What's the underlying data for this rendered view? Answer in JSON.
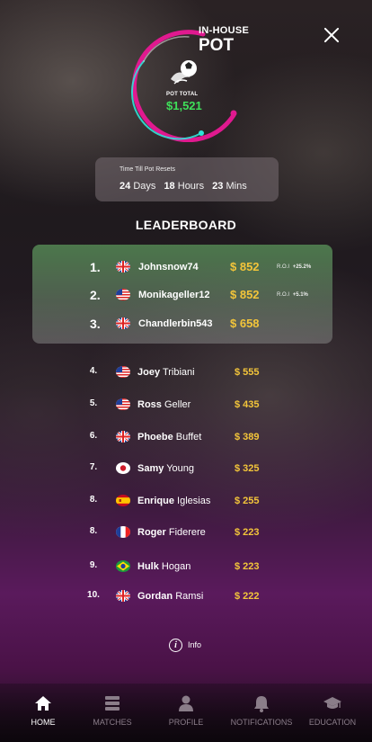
{
  "header": {
    "title_small": "IN-HOUSE",
    "title_big": "POT",
    "pot_total_label": "POT TOTAL",
    "pot_total_value": "$1,521",
    "close_icon": "close-icon"
  },
  "timer": {
    "label": "Time Till Pot Resets",
    "days": "24",
    "days_unit": "Days",
    "hours": "18",
    "hours_unit": "Hours",
    "mins": "23",
    "mins_unit": "Mins"
  },
  "leaderboard": {
    "title": "LEADERBOARD",
    "top": [
      {
        "rank": "1.",
        "flag": "uk",
        "name": "Johnsnow74",
        "amount": "$ 852",
        "roi_label": "R.O.I",
        "roi_value": "+25.2%"
      },
      {
        "rank": "2.",
        "flag": "us",
        "name": "Monikageller12",
        "amount": "$ 852",
        "roi_label": "R.O.I",
        "roi_value": "+5.1%"
      },
      {
        "rank": "3.",
        "flag": "uk",
        "name": "Chandlerbin543",
        "amount": "$ 658",
        "roi_label": "",
        "roi_value": ""
      }
    ],
    "rows": [
      {
        "rank": "4.",
        "flag": "us",
        "first": "Joey",
        "last": "Tribiani",
        "amount": "$ 555"
      },
      {
        "rank": "5.",
        "flag": "us",
        "first": "Ross",
        "last": "Geller",
        "amount": "$ 435"
      },
      {
        "rank": "6.",
        "flag": "uk",
        "first": "Phoebe",
        "last": "Buffet",
        "amount": "$ 389"
      },
      {
        "rank": "7.",
        "flag": "jp",
        "first": "Samy",
        "last": "Young",
        "amount": "$ 325"
      },
      {
        "rank": "8.",
        "flag": "es",
        "first": "Enrique",
        "last": "Iglesias",
        "amount": "$ 255"
      },
      {
        "rank": "8.",
        "flag": "fr",
        "first": "Roger",
        "last": "Fiderere",
        "amount": "$ 223"
      },
      {
        "rank": "9.",
        "flag": "br",
        "first": "Hulk",
        "last": "Hogan",
        "amount": "$ 223"
      },
      {
        "rank": "10.",
        "flag": "uk",
        "first": "Gordan",
        "last": "Ramsi",
        "amount": "$ 222"
      }
    ]
  },
  "info": {
    "label": "Info",
    "icon": "info-icon"
  },
  "nav": [
    {
      "label": "HOME",
      "icon": "home-icon",
      "active": true
    },
    {
      "label": "MATCHES",
      "icon": "matches-icon",
      "active": false
    },
    {
      "label": "PROFILE",
      "icon": "profile-icon",
      "active": false
    },
    {
      "label": "NOTIFICATIONS",
      "icon": "bell-icon",
      "active": false
    },
    {
      "label": "EDUCATION",
      "icon": "graduation-cap-icon",
      "active": false
    }
  ],
  "colors": {
    "amount": "#f3c53a",
    "pot_total": "#3fe05a",
    "ring_outer": "#e0198f",
    "ring_inner": "#2fe3d8"
  }
}
